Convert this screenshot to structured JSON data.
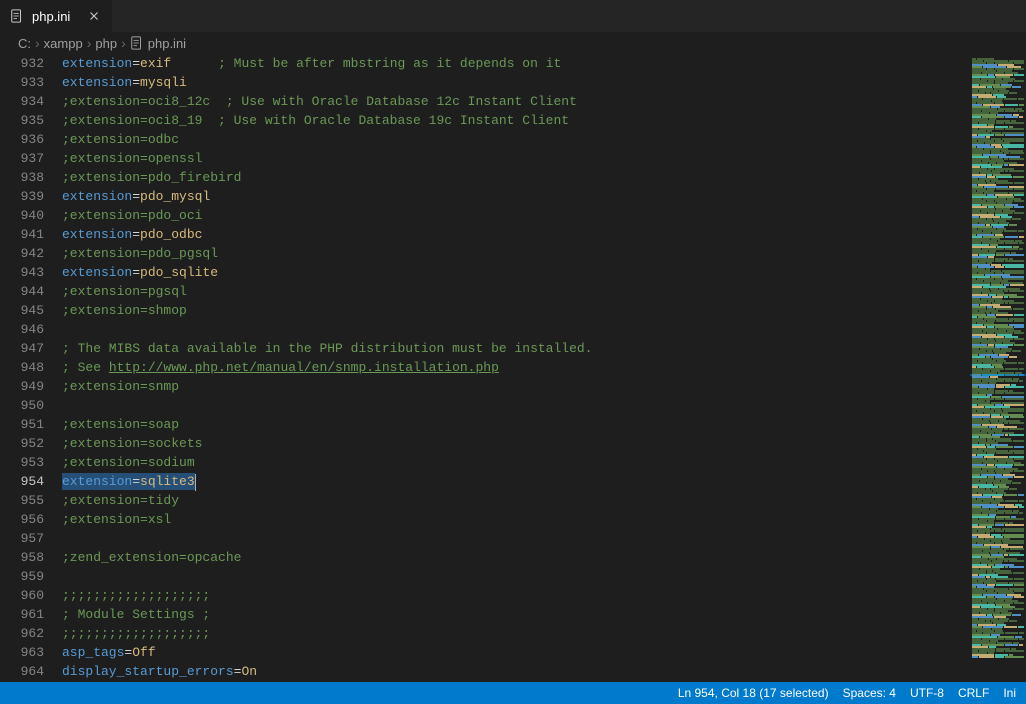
{
  "tab": {
    "filename": "php.ini",
    "icon": "file-config-icon"
  },
  "breadcrumb": {
    "parts": [
      "C:",
      "xampp",
      "php"
    ],
    "file": "php.ini"
  },
  "editor": {
    "active_line": 954,
    "lines": [
      {
        "n": 932,
        "tokens": [
          {
            "t": "key",
            "v": "extension"
          },
          {
            "t": "eq",
            "v": "="
          },
          {
            "t": "val",
            "v": "exif"
          },
          {
            "t": "space",
            "v": "      "
          },
          {
            "t": "cmt",
            "v": "; Must be after mbstring as it depends on it"
          }
        ]
      },
      {
        "n": 933,
        "tokens": [
          {
            "t": "key",
            "v": "extension"
          },
          {
            "t": "eq",
            "v": "="
          },
          {
            "t": "val",
            "v": "mysqli"
          }
        ]
      },
      {
        "n": 934,
        "tokens": [
          {
            "t": "cmt",
            "v": ";extension=oci8_12c  ; Use with Oracle Database 12c Instant Client"
          }
        ]
      },
      {
        "n": 935,
        "tokens": [
          {
            "t": "cmt",
            "v": ";extension=oci8_19  ; Use with Oracle Database 19c Instant Client"
          }
        ]
      },
      {
        "n": 936,
        "tokens": [
          {
            "t": "cmt",
            "v": ";extension=odbc"
          }
        ]
      },
      {
        "n": 937,
        "tokens": [
          {
            "t": "cmt",
            "v": ";extension=openssl"
          }
        ]
      },
      {
        "n": 938,
        "tokens": [
          {
            "t": "cmt",
            "v": ";extension=pdo_firebird"
          }
        ]
      },
      {
        "n": 939,
        "tokens": [
          {
            "t": "key",
            "v": "extension"
          },
          {
            "t": "eq",
            "v": "="
          },
          {
            "t": "val",
            "v": "pdo_mysql"
          }
        ]
      },
      {
        "n": 940,
        "tokens": [
          {
            "t": "cmt",
            "v": ";extension=pdo_oci"
          }
        ]
      },
      {
        "n": 941,
        "tokens": [
          {
            "t": "key",
            "v": "extension"
          },
          {
            "t": "eq",
            "v": "="
          },
          {
            "t": "val",
            "v": "pdo_odbc"
          }
        ]
      },
      {
        "n": 942,
        "tokens": [
          {
            "t": "cmt",
            "v": ";extension=pdo_pgsql"
          }
        ]
      },
      {
        "n": 943,
        "tokens": [
          {
            "t": "key",
            "v": "extension"
          },
          {
            "t": "eq",
            "v": "="
          },
          {
            "t": "val",
            "v": "pdo_sqlite"
          }
        ]
      },
      {
        "n": 944,
        "tokens": [
          {
            "t": "cmt",
            "v": ";extension=pgsql"
          }
        ]
      },
      {
        "n": 945,
        "tokens": [
          {
            "t": "cmt",
            "v": ";extension=shmop"
          }
        ]
      },
      {
        "n": 946,
        "tokens": []
      },
      {
        "n": 947,
        "tokens": [
          {
            "t": "cmt",
            "v": "; The MIBS data available in the PHP distribution must be installed."
          }
        ]
      },
      {
        "n": 948,
        "tokens": [
          {
            "t": "cmt",
            "v": "; See "
          },
          {
            "t": "link",
            "v": "http://www.php.net/manual/en/snmp.installation.php"
          }
        ]
      },
      {
        "n": 949,
        "tokens": [
          {
            "t": "cmt",
            "v": ";extension=snmp"
          }
        ]
      },
      {
        "n": 950,
        "tokens": []
      },
      {
        "n": 951,
        "tokens": [
          {
            "t": "cmt",
            "v": ";extension=soap"
          }
        ]
      },
      {
        "n": 952,
        "tokens": [
          {
            "t": "cmt",
            "v": ";extension=sockets"
          }
        ]
      },
      {
        "n": 953,
        "tokens": [
          {
            "t": "cmt",
            "v": ";extension=sodium"
          }
        ]
      },
      {
        "n": 954,
        "selected": true,
        "tokens": [
          {
            "t": "key",
            "v": "extension"
          },
          {
            "t": "eq",
            "v": "="
          },
          {
            "t": "val",
            "v": "sqlite3"
          }
        ]
      },
      {
        "n": 955,
        "tokens": [
          {
            "t": "cmt",
            "v": ";extension=tidy"
          }
        ]
      },
      {
        "n": 956,
        "tokens": [
          {
            "t": "cmt",
            "v": ";extension=xsl"
          }
        ]
      },
      {
        "n": 957,
        "tokens": []
      },
      {
        "n": 958,
        "tokens": [
          {
            "t": "cmt",
            "v": ";zend_extension=opcache"
          }
        ]
      },
      {
        "n": 959,
        "tokens": []
      },
      {
        "n": 960,
        "tokens": [
          {
            "t": "cmt",
            "v": ";;;;;;;;;;;;;;;;;;;"
          }
        ]
      },
      {
        "n": 961,
        "tokens": [
          {
            "t": "cmt",
            "v": "; Module Settings ;"
          }
        ]
      },
      {
        "n": 962,
        "tokens": [
          {
            "t": "cmt",
            "v": ";;;;;;;;;;;;;;;;;;;"
          }
        ]
      },
      {
        "n": 963,
        "tokens": [
          {
            "t": "key",
            "v": "asp_tags"
          },
          {
            "t": "eq",
            "v": "="
          },
          {
            "t": "val",
            "v": "Off"
          }
        ]
      },
      {
        "n": 964,
        "tokens": [
          {
            "t": "key",
            "v": "display_startup_errors"
          },
          {
            "t": "eq",
            "v": "="
          },
          {
            "t": "val",
            "v": "On"
          }
        ]
      }
    ]
  },
  "status": {
    "position": "Ln 954, Col 18 (17 selected)",
    "spaces": "Spaces: 4",
    "encoding": "UTF-8",
    "eol": "CRLF",
    "lang": "Ini"
  }
}
